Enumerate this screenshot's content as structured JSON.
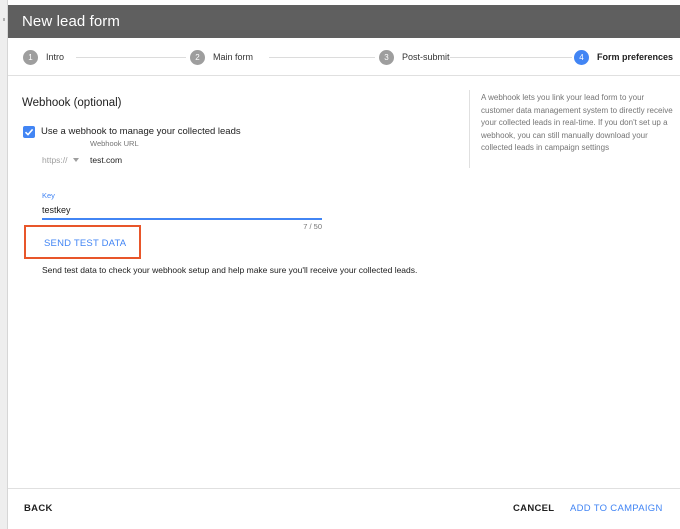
{
  "window": {
    "title": "New lead form"
  },
  "stepper": {
    "steps": [
      {
        "number": "1",
        "label": "Intro",
        "active": false
      },
      {
        "number": "2",
        "label": "Main form",
        "active": false
      },
      {
        "number": "3",
        "label": "Post-submit",
        "active": false
      },
      {
        "number": "4",
        "label": "Form preferences",
        "active": true
      }
    ]
  },
  "webhook": {
    "section_title": "Webhook (optional)",
    "checkbox_label": "Use a webhook to manage your collected leads",
    "checkbox_checked": true,
    "url_label": "Webhook URL",
    "url_scheme": "https://",
    "url_value": "test.com",
    "key_label": "Key",
    "key_value": "testkey",
    "key_counter": "7 / 50",
    "send_test_label": "SEND TEST DATA",
    "help_text": "Send test data to check your webhook setup and help make sure you'll receive your collected leads."
  },
  "sidebar": {
    "description": "A webhook lets you link your lead form to your customer data management system to directly receive your collected leads in real-time. If you don't set up a webhook, you can still manually download your collected leads in campaign settings"
  },
  "footer": {
    "back_label": "BACK",
    "cancel_label": "CANCEL",
    "add_label": "ADD TO CAMPAIGN"
  },
  "colors": {
    "accent": "#4285f4",
    "highlight": "#e8562a",
    "titlebar": "#5f5f5f"
  },
  "icons": {
    "checkbox": "check-icon",
    "scheme_dropdown": "chevron-down-icon"
  }
}
